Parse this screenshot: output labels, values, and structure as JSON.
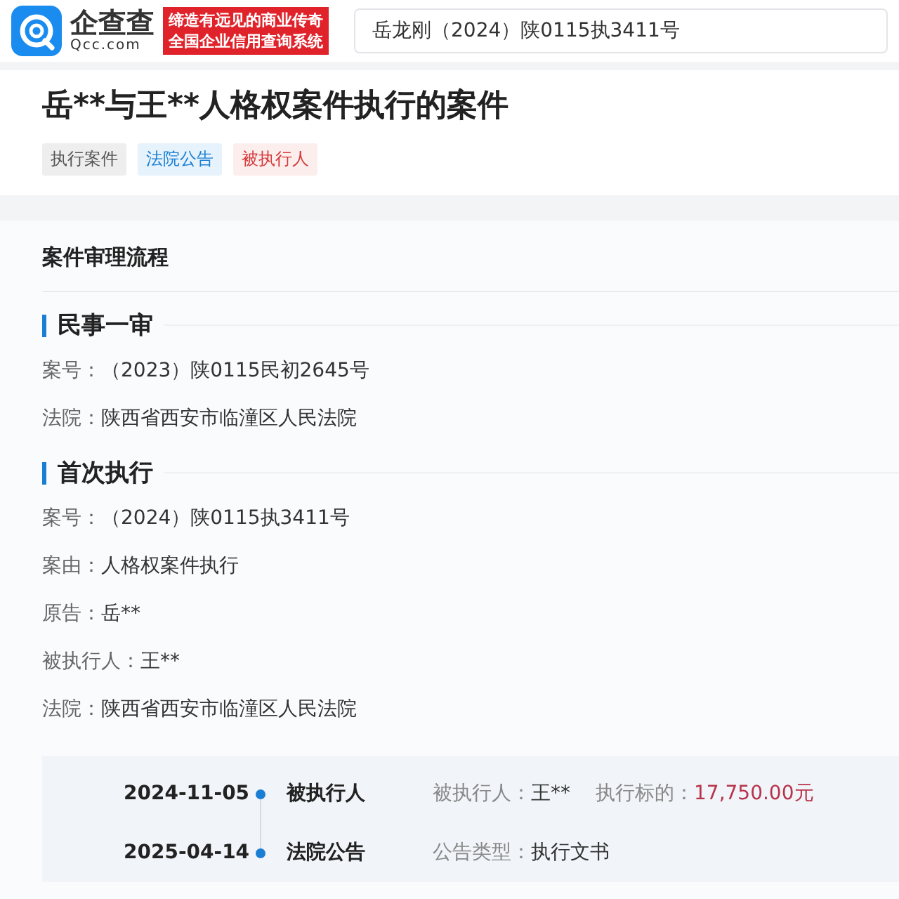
{
  "header": {
    "logo_name": "企查查",
    "logo_domain": "Qcc.com",
    "slogan": [
      "缔造有远见的商业传奇",
      "全国企业信用查询系统"
    ],
    "search": {
      "value": "岳龙刚（2024）陕0115执3411号"
    }
  },
  "case": {
    "title": "岳**与王**人格权案件执行的案件",
    "tags": [
      {
        "label": "执行案件",
        "kind": "gray"
      },
      {
        "label": "法院公告",
        "kind": "blue"
      },
      {
        "label": "被执行人",
        "kind": "red"
      }
    ]
  },
  "process": {
    "heading": "案件审理流程",
    "sections": [
      {
        "title": "民事一审",
        "fields": [
          {
            "label": "案号：",
            "value": "（2023）陕0115民初2645号"
          },
          {
            "label": "法院：",
            "value": "陕西省西安市临潼区人民法院"
          }
        ]
      },
      {
        "title": "首次执行",
        "fields": [
          {
            "label": "案号：",
            "value": "（2024）陕0115执3411号"
          },
          {
            "label": "案由：",
            "value": "人格权案件执行"
          },
          {
            "label": "原告：",
            "value": "岳**"
          },
          {
            "label": "被执行人：",
            "value": "王**"
          },
          {
            "label": "法院：",
            "value": "陕西省西安市临潼区人民法院"
          }
        ]
      }
    ],
    "timeline": [
      {
        "date": "2024-11-05",
        "type": "被执行人",
        "details": [
          {
            "label": "被执行人：",
            "value": "王**",
            "kind": "plain"
          },
          {
            "label": "执行标的：",
            "value": "17,750.00元",
            "kind": "amount"
          }
        ]
      },
      {
        "date": "2025-04-14",
        "type": "法院公告",
        "details": [
          {
            "label": "公告类型：",
            "value": "执行文书",
            "kind": "plain"
          }
        ]
      }
    ]
  }
}
